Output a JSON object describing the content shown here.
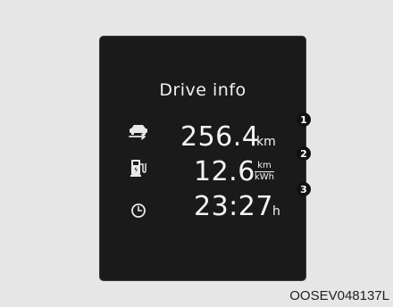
{
  "panel": {
    "title": "Drive info",
    "rows": [
      {
        "icon": "car-arrow-icon",
        "value": "256.4",
        "unit": "km",
        "callout": "1"
      },
      {
        "icon": "charging-station-icon",
        "value": "12.6",
        "unit_num": "km",
        "unit_den": "kWh",
        "callout": "2"
      },
      {
        "icon": "clock-icon",
        "value": "23:27",
        "unit": "h",
        "callout": "3"
      }
    ]
  },
  "caption": "OOSEV048137L"
}
